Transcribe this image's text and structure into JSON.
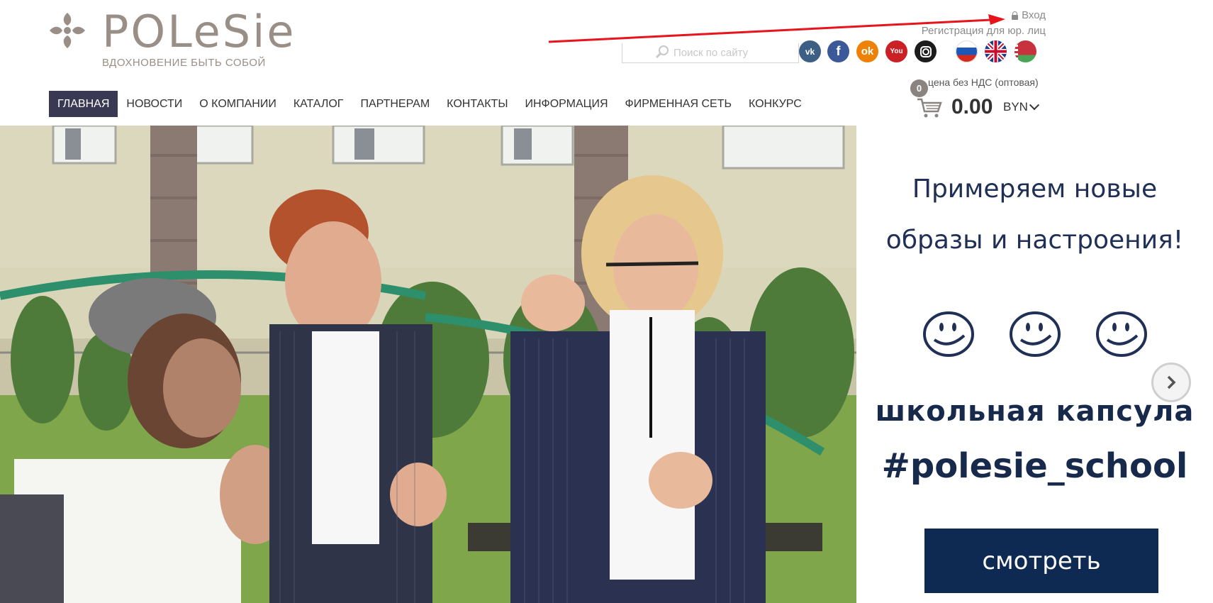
{
  "brand": {
    "name": "POLeSie",
    "tagline": "ВДОХНОВЕНИЕ БЫТЬ СОБОЙ",
    "color": "#9a8f86"
  },
  "account": {
    "login": "Вход",
    "register": "Регистрация для юр. лиц"
  },
  "search": {
    "placeholder": "Поиск по сайту"
  },
  "social": [
    {
      "icon": "vk-icon",
      "label": "vk"
    },
    {
      "icon": "facebook-icon",
      "label": "f"
    },
    {
      "icon": "odnoklassniki-icon",
      "label": "ok"
    },
    {
      "icon": "youtube-icon",
      "label": "You"
    },
    {
      "icon": "instagram-icon",
      "label": ""
    }
  ],
  "languages": [
    "ru-flag-icon",
    "en-flag-icon",
    "by-flag-icon"
  ],
  "cart": {
    "count": "0",
    "price_note": "цена без НДС (оптовая)",
    "total": "0.00",
    "currency": "BYN"
  },
  "nav": {
    "items": [
      "ГЛАВНАЯ",
      "НОВОСТИ",
      "О КОМПАНИИ",
      "КАТАЛОГ",
      "ПАРТНЕРАМ",
      "КОНТАКТЫ",
      "ИНФОРМАЦИЯ",
      "ФИРМЕННАЯ СЕТЬ",
      "КОНКУРС"
    ],
    "active_index": 0
  },
  "promo": {
    "title_line1": "Примеряем новые",
    "title_line2": "образы и настроения!",
    "capsule": "школьная капсула",
    "hashtag": "#polesie_school",
    "button": "смотреть",
    "accent": "#0e2a52"
  },
  "colors": {
    "nav_active": "#3a3953",
    "annotation_arrow": "#e8141b"
  }
}
